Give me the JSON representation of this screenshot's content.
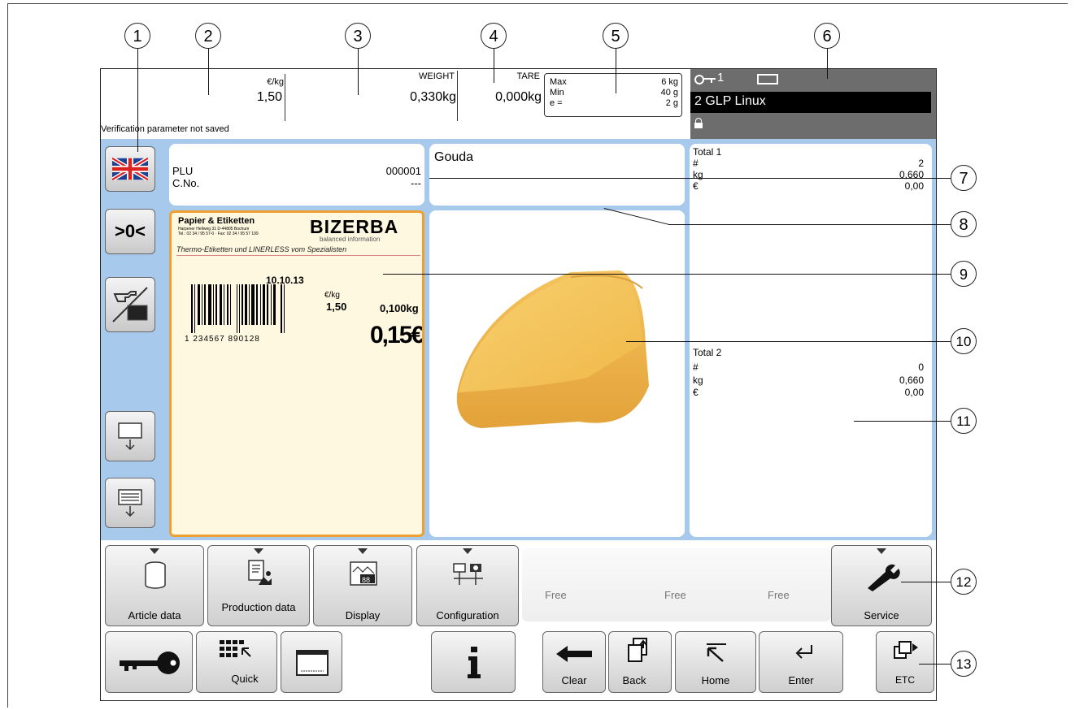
{
  "callouts": [
    "1",
    "2",
    "3",
    "4",
    "5",
    "6",
    "7",
    "8",
    "9",
    "10",
    "11",
    "12",
    "13"
  ],
  "header": {
    "price_unit": "€/kg",
    "price_value": "1,50",
    "weight_label": "WEIGHT",
    "weight_value": "0,330kg",
    "tare_label": "TARE",
    "tare_value": "0,000kg",
    "status_text": "Verification parameter not saved",
    "scale_max_label": "Max",
    "scale_max_value": "6 kg",
    "scale_min_label": "Min",
    "scale_min_value": "40 g",
    "scale_e_label": "e =",
    "scale_e_value": "2 g",
    "key_number": "1",
    "device_name": "2 GLP Linux"
  },
  "plu": {
    "plu_label": "PLU",
    "plu_value": "000001",
    "cno_label": "C.No.",
    "cno_value": "---"
  },
  "article_name": "Gouda",
  "total1": {
    "title": "Total 1",
    "rows": [
      {
        "label": "#",
        "value": "2"
      },
      {
        "label": "kg",
        "value": "0,660"
      },
      {
        "label": "€",
        "value": "0,00"
      }
    ]
  },
  "total2": {
    "title": "Total 2",
    "rows": [
      {
        "label": "#",
        "value": "0"
      },
      {
        "label": "kg",
        "value": "0,660"
      },
      {
        "label": "€",
        "value": "0,00"
      }
    ]
  },
  "label_preview": {
    "company_name": "Papier & Etiketten",
    "company_address": "Harpener Hellweg 31 D-44805 Bochum",
    "company_phone": "Tel.: 02 34 / 95 57-0 · Fax: 02 34 / 95 57 199",
    "brand": "BIZERBA",
    "brand_tagline": "balanced information",
    "slogan": "Thermo-Etiketten und LINERLESS vom Spezialisten",
    "date": "10.10.13",
    "unit_price_label": "€/kg",
    "unit_price": "1,50",
    "weight": "0,100kg",
    "price": "0,15€",
    "barcode_digits": "1 234567 890128"
  },
  "side_buttons": {
    "language_flag": "uk-flag-icon",
    "zero_label": ">0<"
  },
  "function_keys": [
    {
      "label": "Article data"
    },
    {
      "label": "Production data"
    },
    {
      "label": "Display"
    },
    {
      "label": "Configuration"
    },
    {
      "label": "Free"
    },
    {
      "label": "Free"
    },
    {
      "label": "Free"
    },
    {
      "label": "Service"
    }
  ],
  "bottom_keys": {
    "quick": "Quick",
    "clear": "Clear",
    "back": "Back",
    "home": "Home",
    "enter": "Enter",
    "etc": "ETC"
  },
  "colors": {
    "screen_blue": "#a6c9ec",
    "status_panel": "#6d6d6d",
    "label_orange": "#f0a030",
    "label_fill": "#fff8e1"
  }
}
